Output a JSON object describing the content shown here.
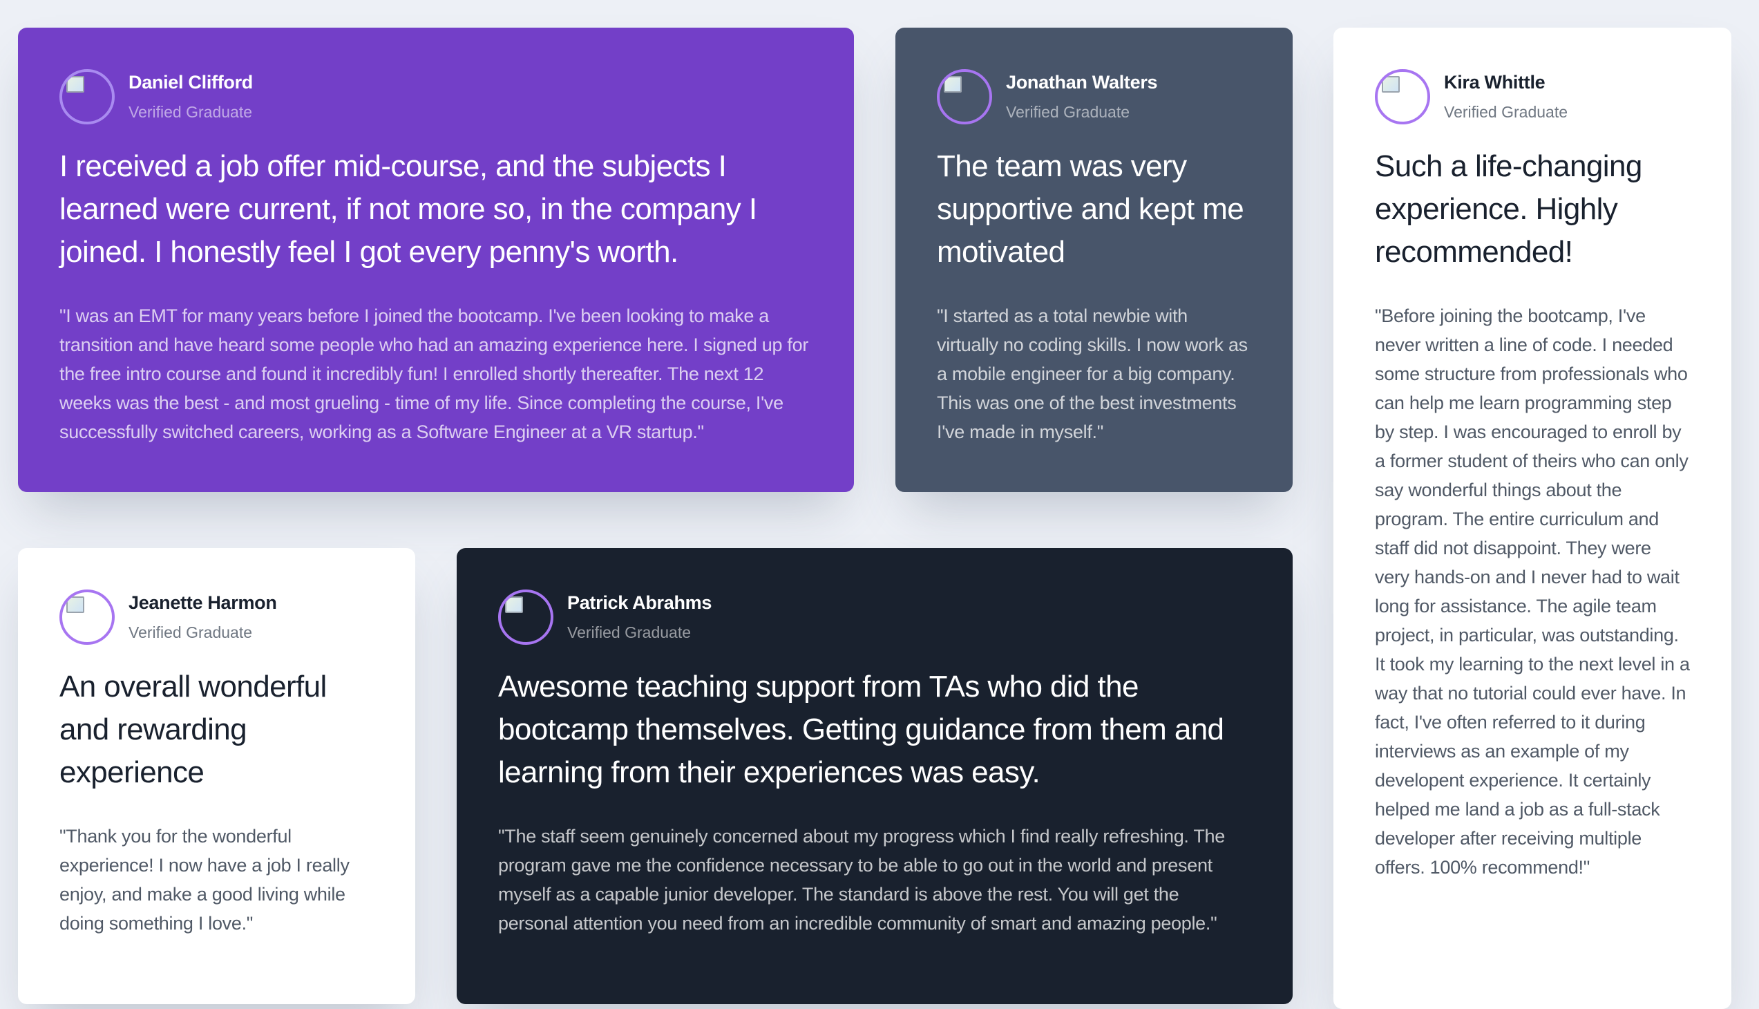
{
  "testimonials": {
    "daniel": {
      "name": "Daniel Clifford",
      "status": "Verified Graduate",
      "headline": "I received a job offer mid-course, and the subjects I learned were current, if not more so, in the company I joined. I honestly feel I got every penny's worth.",
      "quote": "\"I was an EMT for many years before I joined the bootcamp. I've been looking to make a transition and have heard some people who had an amazing experience here. I signed up for the free intro course and found it incredibly fun! I enrolled shortly thereafter. The next 12 weeks was the best - and most grueling - time of my life. Since completing the course, I've successfully switched careers, working as a Software Engineer at a VR startup.\"",
      "avatar_icon": "broken-image-icon"
    },
    "jonathan": {
      "name": "Jonathan Walters",
      "status": "Verified Graduate",
      "headline": "The team was very supportive and kept me motivated",
      "quote": "\"I started as a total newbie with virtually no coding skills. I now work as a mobile engineer for a big company. This was one of the best investments I've made in myself.\"",
      "avatar_icon": "broken-image-icon"
    },
    "kira": {
      "name": "Kira Whittle",
      "status": "Verified Graduate",
      "headline": "Such a life-changing experience. Highly recommended!",
      "quote": "\"Before joining the bootcamp, I've never written a line of code. I needed some structure from professionals who can help me learn programming step by step. I was encouraged to enroll by a former student of theirs who can only say wonderful things about the program. The entire curriculum and staff did not disappoint. They were very hands-on and I never had to wait long for assistance. The agile team project, in particular, was outstanding. It took my learning to the next level in a way that no tutorial could ever have. In fact, I've often referred to it during interviews as an example of my developent experience. It certainly helped me land a job as a full-stack developer after receiving multiple offers. 100% recommend!\"",
      "avatar_icon": "broken-image-icon"
    },
    "jeanette": {
      "name": "Jeanette Harmon",
      "status": "Verified Graduate",
      "headline": "An overall wonderful and rewarding experience",
      "quote": "\"Thank you for the wonderful experience! I now have a job I really enjoy, and make a good living while doing something I love.\"",
      "avatar_icon": "broken-image-icon"
    },
    "patrick": {
      "name": "Patrick Abrahms",
      "status": "Verified Graduate",
      "headline": "Awesome teaching support from TAs who did the bootcamp themselves. Getting guidance from them and learning from their experiences was easy.",
      "quote": "\"The staff seem genuinely concerned about my progress which I find really refreshing. The program gave me the confidence necessary to be able to go out in the world and present myself as a capable junior developer. The standard is above the rest. You will get the personal attention you need from an incredible community of smart and amazing people.\"",
      "avatar_icon": "broken-image-icon"
    }
  },
  "colors": {
    "page_background": "#edf0f6",
    "violet": "#733fc8",
    "grayish_blue": "#48556a",
    "blackish_blue": "#19212e",
    "white": "#ffffff",
    "avatar_ring": "#a775f1"
  }
}
